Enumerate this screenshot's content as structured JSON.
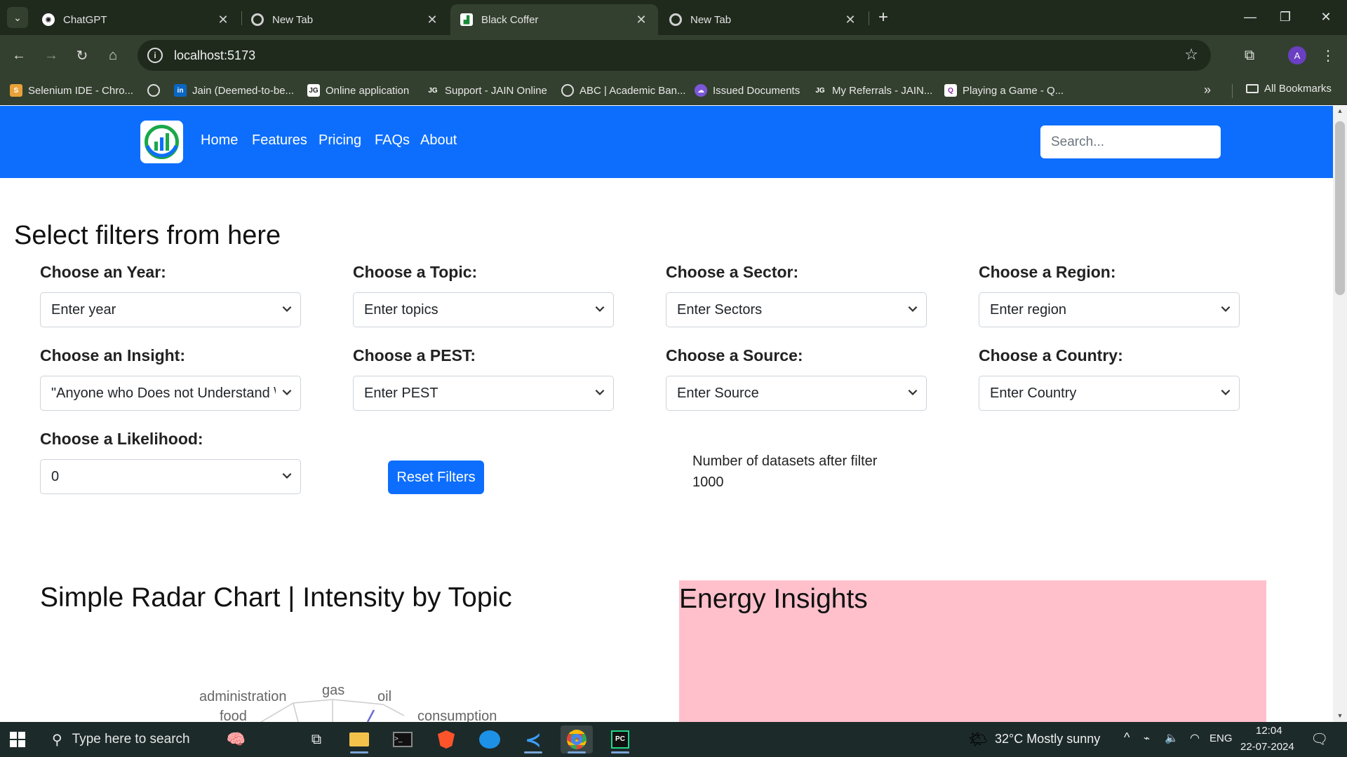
{
  "browser": {
    "tabs": [
      {
        "title": "ChatGPT",
        "icon": "chatgpt-icon"
      },
      {
        "title": "New Tab",
        "icon": "chrome-icon"
      },
      {
        "title": "Black Coffer",
        "icon": "site-favicon"
      },
      {
        "title": "New Tab",
        "icon": "chrome-icon"
      }
    ],
    "url": "localhost:5173",
    "bookmarks": [
      "Selenium IDE - Chro...",
      "Jain (Deemed-to-be...",
      "Online application",
      "Support - JAIN Online",
      "ABC | Academic Ban...",
      "Issued Documents",
      "My Referrals - JAIN...",
      "Playing a Game - Q..."
    ],
    "all_bookmarks": "All Bookmarks",
    "profile_initial": "A"
  },
  "navbar": {
    "links": [
      "Home",
      "Features",
      "Pricing",
      "FAQs",
      "About"
    ],
    "search_placeholder": "Search..."
  },
  "filters": {
    "heading": "Select filters from here",
    "items": [
      {
        "label": "Choose an Year:",
        "value": "Enter year"
      },
      {
        "label": "Choose a Topic:",
        "value": "Enter topics"
      },
      {
        "label": "Choose a Sector:",
        "value": "Enter Sectors"
      },
      {
        "label": "Choose a Region:",
        "value": "Enter region"
      },
      {
        "label": "Choose an Insight:",
        "value": "\"Anyone who Does not Understand \\"
      },
      {
        "label": "Choose a PEST:",
        "value": "Enter PEST"
      },
      {
        "label": "Choose a Source:",
        "value": "Enter Source"
      },
      {
        "label": "Choose a Country:",
        "value": "Enter Country"
      },
      {
        "label": "Choose a Likelihood:",
        "value": "0"
      }
    ],
    "reset_label": "Reset Filters",
    "count_label": "Number of datasets after filter",
    "count_value": "1000"
  },
  "radar": {
    "title": "Simple Radar Chart | Intensity by Topic",
    "labels": [
      "administration",
      "gas",
      "oil",
      "food",
      "consumption"
    ]
  },
  "energy": {
    "title": "Energy Insights"
  },
  "colors": {
    "primary": "#0d6efd",
    "energy_panel": "#ffc0cb",
    "chrome_dark": "#1f2a1d",
    "chrome_toolbar": "#34402f"
  },
  "taskbar": {
    "search_placeholder": "Type here to search",
    "weather": "32°C  Mostly sunny",
    "language": "ENG",
    "time": "12:04",
    "date": "22-07-2024"
  }
}
